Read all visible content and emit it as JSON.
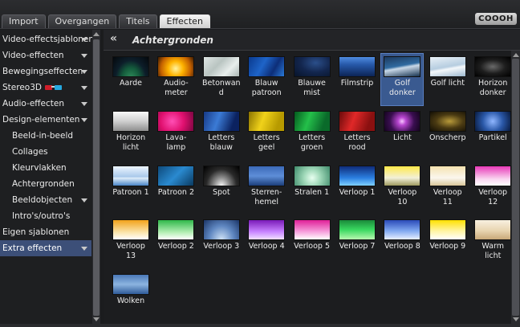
{
  "tabs": [
    {
      "label": "Import",
      "active": false
    },
    {
      "label": "Overgangen",
      "active": false
    },
    {
      "label": "Titels",
      "active": false
    },
    {
      "label": "Effecten",
      "active": true
    }
  ],
  "logo_text": "COOOH",
  "sidebar": {
    "items": [
      {
        "label": "Video-effectsjablonen",
        "caret": true,
        "sub": false,
        "selected": false
      },
      {
        "label": "Video-effecten",
        "caret": true,
        "sub": false,
        "selected": false
      },
      {
        "label": "Bewegingseffecten",
        "caret": true,
        "sub": false,
        "selected": false
      },
      {
        "label": "Stereo3D",
        "caret": true,
        "sub": false,
        "selected": false,
        "icon": "stereo-3d-glasses-icon"
      },
      {
        "label": "Audio-effecten",
        "caret": true,
        "sub": false,
        "selected": false
      },
      {
        "label": "Design-elementen",
        "caret": true,
        "sub": false,
        "selected": false
      },
      {
        "label": "Beeld-in-beeld",
        "caret": false,
        "sub": true,
        "selected": false
      },
      {
        "label": "Collages",
        "caret": false,
        "sub": true,
        "selected": false
      },
      {
        "label": "Kleurvlakken",
        "caret": false,
        "sub": true,
        "selected": false
      },
      {
        "label": "Achtergronden",
        "caret": false,
        "sub": true,
        "selected": false
      },
      {
        "label": "Beeldobjecten",
        "caret": true,
        "sub": true,
        "selected": false
      },
      {
        "label": "Intro's/outro's",
        "caret": false,
        "sub": true,
        "selected": false
      },
      {
        "label": "Eigen sjablonen",
        "caret": false,
        "sub": false,
        "selected": false
      },
      {
        "label": "Extra effecten",
        "caret": true,
        "sub": false,
        "selected": true
      }
    ]
  },
  "main": {
    "back_icon": "«",
    "title": "Achtergronden",
    "selected_tile": "Golf donker",
    "tiles": [
      {
        "label": "Aarde",
        "thumb": "t-aarde"
      },
      {
        "label": "Audio-\nmeter",
        "thumb": "t-audio"
      },
      {
        "label": "Betonwan\nd",
        "thumb": "t-beton"
      },
      {
        "label": "Blauw\npatroon",
        "thumb": "t-bpat"
      },
      {
        "label": "Blauwe\nmist",
        "thumb": "t-bmist"
      },
      {
        "label": "Filmstrip",
        "thumb": "t-film"
      },
      {
        "label": "Golf\ndonker",
        "thumb": "t-golfd",
        "selected": true
      },
      {
        "label": "Golf licht",
        "thumb": "t-golfl"
      },
      {
        "label": "Horizon\ndonker",
        "thumb": "t-hdark"
      },
      {
        "label": "Horizon\nlicht",
        "thumb": "t-hlicht"
      },
      {
        "label": "Lava-\nlamp",
        "thumb": "t-lava"
      },
      {
        "label": "Letters\nblauw",
        "thumb": "t-lblue"
      },
      {
        "label": "Letters\ngeel",
        "thumb": "t-lgeel"
      },
      {
        "label": "Letters\ngroen",
        "thumb": "t-lgroen"
      },
      {
        "label": "Letters\nrood",
        "thumb": "t-lrood"
      },
      {
        "label": "Licht",
        "thumb": "t-licht"
      },
      {
        "label": "Onscherp",
        "thumb": "t-onscherp"
      },
      {
        "label": "Partikel",
        "thumb": "t-partikel"
      },
      {
        "label": "Patroon 1",
        "thumb": "t-pat1"
      },
      {
        "label": "Patroon 2",
        "thumb": "t-pat2"
      },
      {
        "label": "Spot",
        "thumb": "t-spot"
      },
      {
        "label": "Sterren-\nhemel",
        "thumb": "t-sterren"
      },
      {
        "label": "Stralen 1",
        "thumb": "t-stralen"
      },
      {
        "label": "Verloop 1",
        "thumb": "t-v1"
      },
      {
        "label": "Verloop\n10",
        "thumb": "t-v10"
      },
      {
        "label": "Verloop\n11",
        "thumb": "t-v11"
      },
      {
        "label": "Verloop\n12",
        "thumb": "t-v12"
      },
      {
        "label": "Verloop\n13",
        "thumb": "t-v13"
      },
      {
        "label": "Verloop 2",
        "thumb": "t-v2"
      },
      {
        "label": "Verloop 3",
        "thumb": "t-v3"
      },
      {
        "label": "Verloop 4",
        "thumb": "t-v4"
      },
      {
        "label": "Verloop 5",
        "thumb": "t-v5"
      },
      {
        "label": "Verloop 7",
        "thumb": "t-v7"
      },
      {
        "label": "Verloop 8",
        "thumb": "t-v8"
      },
      {
        "label": "Verloop 9",
        "thumb": "t-v9"
      },
      {
        "label": "Warm\nlicht",
        "thumb": "t-warm"
      },
      {
        "label": "Wolken",
        "thumb": "t-wolken"
      }
    ]
  },
  "colors": {
    "selection": "#3a5a90",
    "sidebar_selection": "#3c4f78",
    "background": "#1c1d1f"
  }
}
